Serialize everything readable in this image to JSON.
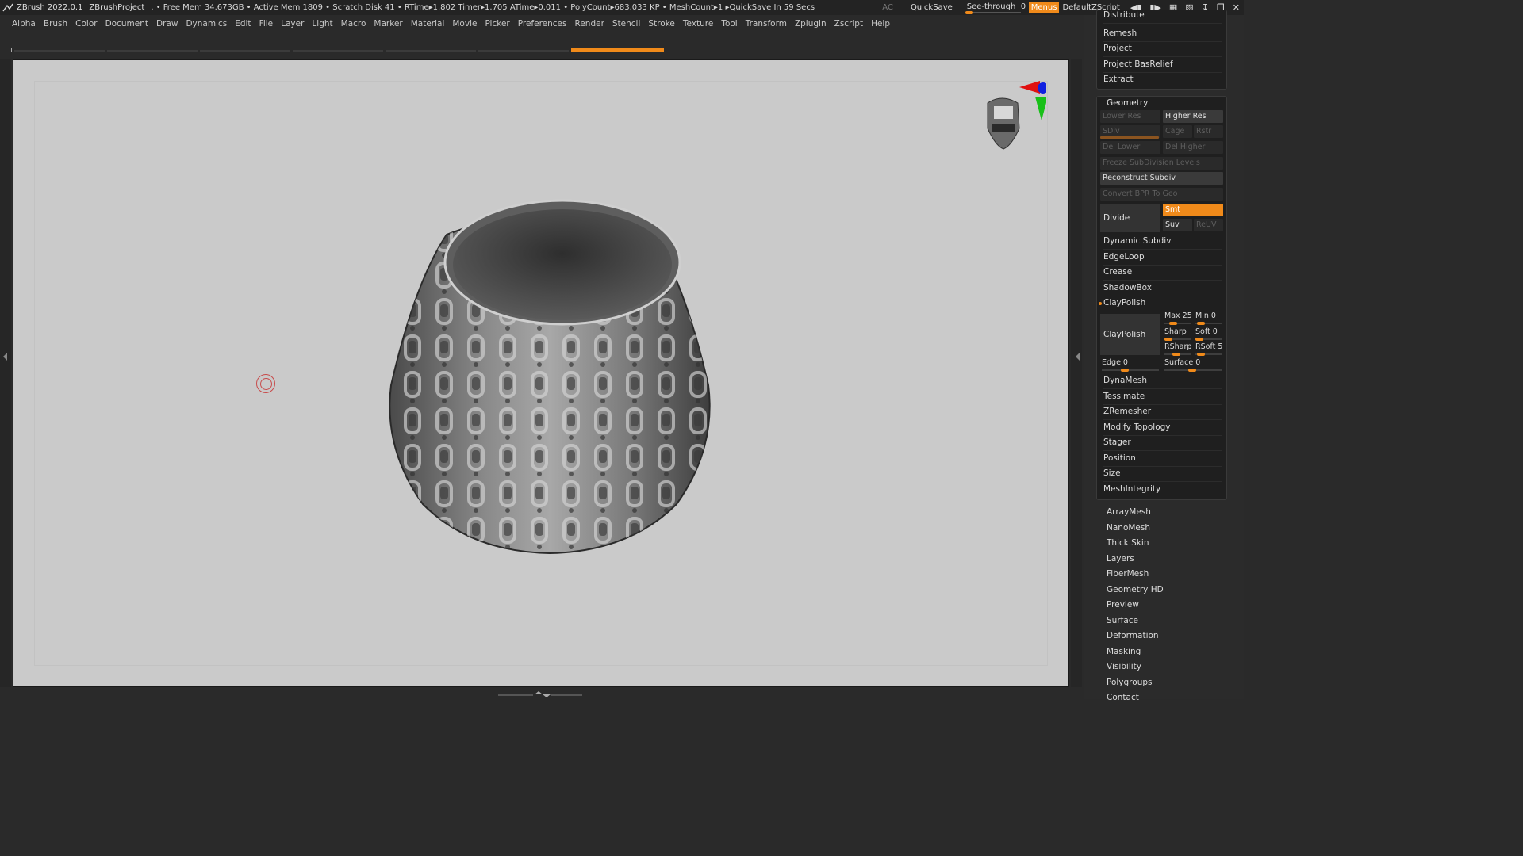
{
  "titlebar": {
    "app": "ZBrush 2022.0.1",
    "project": "ZBrushProject",
    "stats": "  . • Free Mem 34.673GB • Active Mem 1809 • Scratch Disk 41 •  RTime▸1.802 Timer▸1.705 ATime▸0.011 • PolyCount▸683.033 KP  • MeshCount▸1   ▸QuickSave In 59 Secs",
    "ac": "AC",
    "quicksave": "QuickSave",
    "see_through_label": "See-through",
    "see_through_value": "0",
    "see_through_level": 0,
    "menus": "Menus",
    "script": "DefaultZScript",
    "accent": "#f08a1a"
  },
  "menubar": [
    "Alpha",
    "Brush",
    "Color",
    "Document",
    "Draw",
    "Dynamics",
    "Edit",
    "File",
    "Layer",
    "Light",
    "Macro",
    "Marker",
    "Material",
    "Movie",
    "Picker",
    "Preferences",
    "Render",
    "Stencil",
    "Stroke",
    "Texture",
    "Tool",
    "Transform",
    "Zplugin",
    "Zscript",
    "Help"
  ],
  "tray_top": [
    "Distribute",
    "Remesh",
    "Project",
    "Project BasRelief",
    "Extract"
  ],
  "geometry": {
    "title": "Geometry",
    "lower_res": "Lower Res",
    "higher_res": "Higher Res",
    "sdiv": "SDiv",
    "cage": "Cage",
    "rstr": "Rstr",
    "del_lower": "Del Lower",
    "del_higher": "Del Higher",
    "freeze": "Freeze SubDivision Levels",
    "reconstruct": "Reconstruct Subdiv",
    "convert_bpr": "Convert BPR To Geo",
    "divide": "Divide",
    "smt": "Smt",
    "suv": "Suv",
    "reuv": "ReUV",
    "dynamic_subdiv": "Dynamic Subdiv",
    "edgeloop": "EdgeLoop",
    "crease": "Crease",
    "shadowbox": "ShadowBox",
    "claypolish_header": "ClayPolish",
    "claypolish_btn": "ClayPolish",
    "max": "Max 25",
    "min": "Min 0",
    "sharp": "Sharp",
    "soft": "Soft 0",
    "rsharp": "RSharp",
    "rsoft": "RSoft 5",
    "edge": "Edge 0",
    "surface": "Surface 0",
    "after": [
      "DynaMesh",
      "Tessimate",
      "ZRemesher",
      "Modify Topology",
      "Stager",
      "Position",
      "Size",
      "MeshIntegrity"
    ]
  },
  "tray_bottom": [
    "ArrayMesh",
    "NanoMesh",
    "Thick Skin",
    "Layers",
    "FiberMesh",
    "Geometry HD",
    "Preview",
    "Surface",
    "Deformation",
    "Masking",
    "Visibility",
    "Polygroups",
    "Contact"
  ]
}
